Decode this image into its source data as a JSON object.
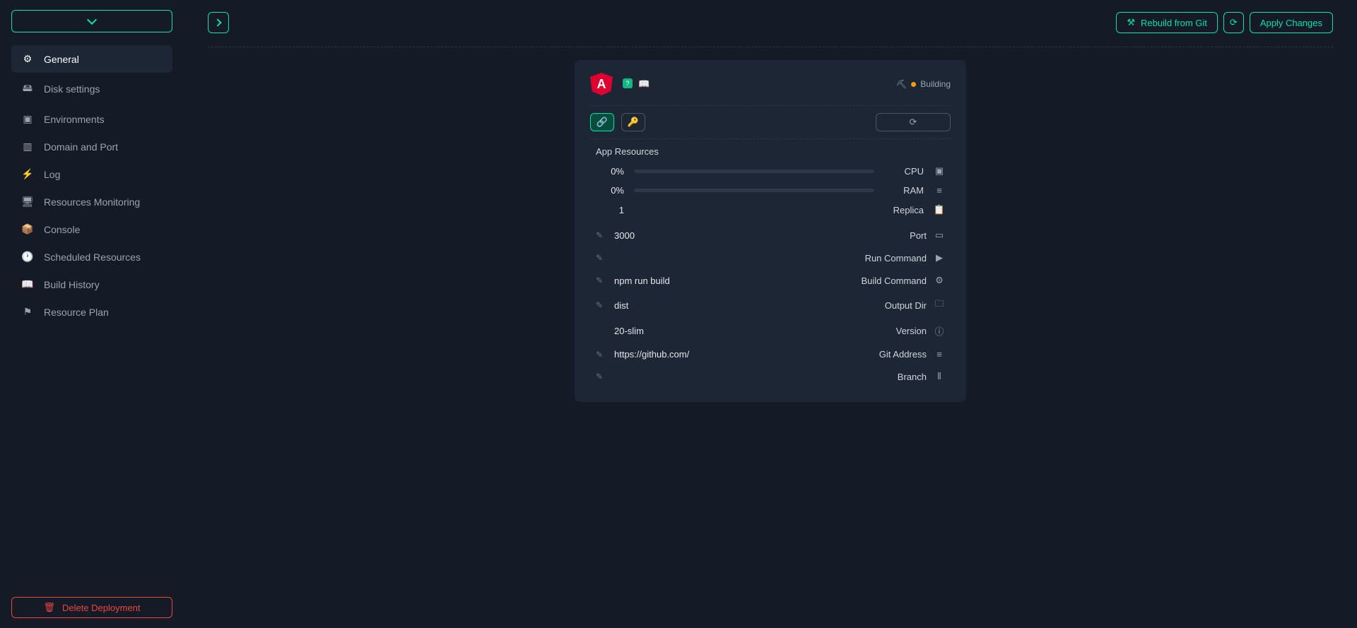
{
  "sidebar": {
    "items": [
      {
        "label": "General",
        "icon": "⚙"
      },
      {
        "label": "Disk settings",
        "icon": "🖴"
      },
      {
        "label": "Environments",
        "icon": "▣"
      },
      {
        "label": "Domain and Port",
        "icon": "▥"
      },
      {
        "label": "Log",
        "icon": "⚡"
      },
      {
        "label": "Resources Monitoring",
        "icon": "🖥"
      },
      {
        "label": "Console",
        "icon": "📦"
      },
      {
        "label": "Scheduled Resources",
        "icon": "🕐"
      },
      {
        "label": "Build History",
        "icon": "📖"
      },
      {
        "label": "Resource Plan",
        "icon": "⚑"
      }
    ],
    "delete_label": "Delete Deployment"
  },
  "topbar": {
    "rebuild_label": "Rebuild from Git",
    "apply_label": "Apply Changes"
  },
  "card": {
    "logo_letter": "A",
    "status": "Building",
    "section_title": "App Resources",
    "resources": {
      "cpu": {
        "value": "0%",
        "label": "CPU",
        "icon": "▣"
      },
      "ram": {
        "value": "0%",
        "label": "RAM",
        "icon": "≡"
      },
      "replica": {
        "value": "1",
        "label": "Replica",
        "icon": "📋"
      }
    },
    "rows": [
      {
        "value": "3000",
        "label": "Port",
        "icon": "▭",
        "editable": true
      },
      {
        "value": "",
        "label": "Run Command",
        "icon": "▶",
        "editable": true
      },
      {
        "value": "npm run build",
        "label": "Build Command",
        "icon": "⚙",
        "editable": true
      },
      {
        "value": "dist",
        "label": "Output Dir",
        "icon": "🗀",
        "editable": true
      },
      {
        "value": "20-slim",
        "label": "Version",
        "icon": "ⓘ",
        "editable": false
      },
      {
        "value": "https://github.com/",
        "label": "Git Address",
        "icon": "≡",
        "editable": true
      },
      {
        "value": "",
        "label": "Branch",
        "icon": "⦀",
        "editable": true
      }
    ]
  }
}
